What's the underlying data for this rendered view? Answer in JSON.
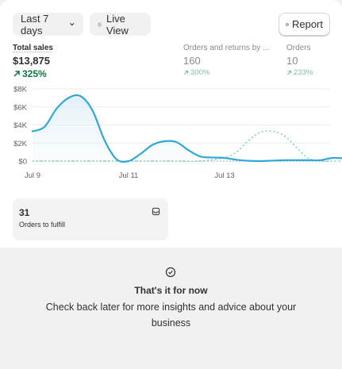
{
  "toolbar": {
    "date_range_label": "Last 7 days",
    "live_view_label": "Live View",
    "report_label": "Report"
  },
  "metrics": {
    "total_sales": {
      "label": "Total sales",
      "value": "$13,875",
      "delta": "325%"
    },
    "orders_returns": {
      "label": "Orders and returns by ...",
      "value": "160",
      "delta": "300%"
    },
    "orders": {
      "label": "Orders",
      "value": "10",
      "delta": "233%"
    }
  },
  "chart_data": {
    "type": "line",
    "y_ticks": [
      "$8K",
      "$6K",
      "$4K",
      "$2K",
      "$0"
    ],
    "x_ticks": [
      "Jul 9",
      "Jul 11",
      "Jul 13"
    ],
    "ylim": [
      0,
      8000
    ],
    "grid": true,
    "colors": {
      "current": "#31a9d6",
      "comparison": "#7fcfbf"
    },
    "series": [
      {
        "x": [
          0,
          0.25,
          0.5,
          0.75,
          1,
          1.25,
          1.5,
          1.75,
          2,
          2.25,
          2.5,
          2.75,
          3,
          3.25,
          3.5,
          3.75,
          4,
          4.25,
          4.5,
          4.75,
          5,
          5.25,
          5.5,
          5.75,
          6,
          6.25,
          6.5
        ],
        "values": [
          3300,
          3800,
          5800,
          7000,
          7200,
          5600,
          2300,
          200,
          0,
          800,
          1800,
          2200,
          2100,
          1200,
          500,
          400,
          350,
          150,
          30,
          0,
          50,
          100,
          100,
          100,
          100,
          350,
          300
        ]
      },
      {
        "x": [
          0,
          0.5,
          1,
          1.5,
          2,
          2.5,
          3,
          3.5,
          4,
          4.25,
          4.5,
          4.75,
          5,
          5.25,
          5.5,
          5.75,
          6,
          6.25,
          6.5
        ],
        "values": [
          0,
          0,
          0,
          0,
          0,
          0,
          0,
          0,
          400,
          1000,
          2300,
          3200,
          3300,
          2800,
          1500,
          300,
          0,
          0,
          0
        ]
      }
    ]
  },
  "fulfill": {
    "count": "31",
    "label": "Orders to fulfill"
  },
  "empty_state": {
    "title": "That's it for now",
    "text": "Check back later for more insights and advice about your business"
  }
}
